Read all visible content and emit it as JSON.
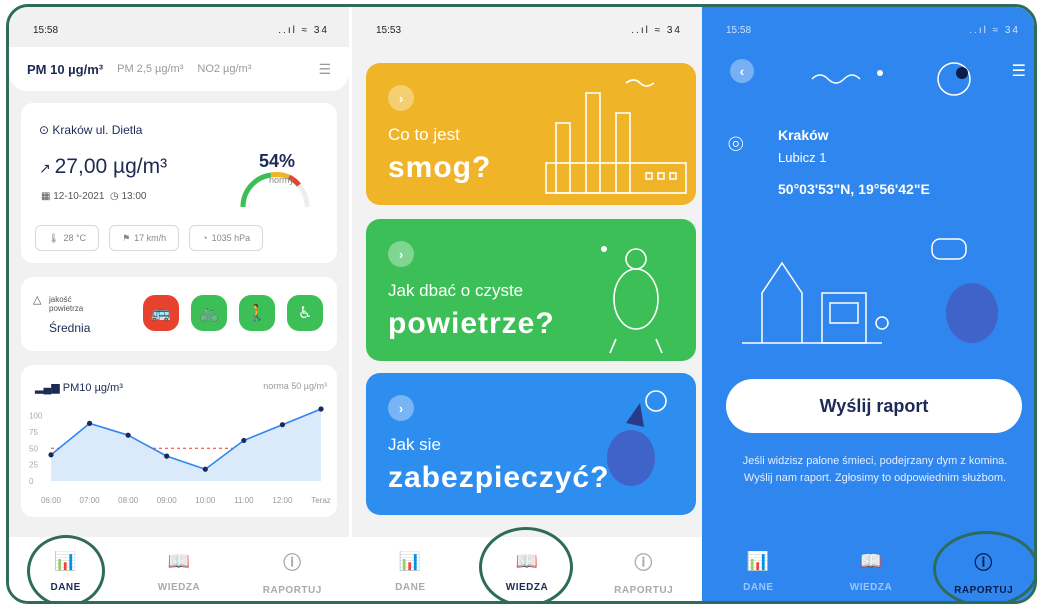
{
  "screen_dane": {
    "time": "15:58",
    "status_icons": "..ıl ≈ 34",
    "tabs": [
      "PM 10 µg/m³",
      "PM 2,5 µg/m³",
      "NO2 µg/m³"
    ],
    "location": "Kraków ul. Dietla",
    "value": "27,00 µg/m³",
    "norm_pct": "54%",
    "norm_label": "normy",
    "date": "12-10-2021",
    "hour": "13:00",
    "temperature": "28 °C",
    "wind": "17 km/h",
    "pressure": "1035 hPa",
    "air_quality_label": "jakość powietrza",
    "air_quality_value": "Średnia",
    "chart_title": "PM10 µg/m³",
    "chart_norm": "norma 50 µg/m³"
  },
  "chart_data": {
    "type": "line",
    "title": "PM10 µg/m³",
    "x": [
      "06:00",
      "07:00",
      "08:00",
      "09:00",
      "10:00",
      "11:00",
      "12:00",
      "Teraz"
    ],
    "y_ticks": [
      "100",
      "75",
      "50",
      "25",
      "0"
    ],
    "series": [
      {
        "values": [
          40,
          88,
          70,
          38,
          18,
          62,
          86,
          110
        ]
      }
    ],
    "norm_line": 50,
    "ylim": [
      0,
      110
    ]
  },
  "screen_wiedza": {
    "time": "15:53",
    "cards": [
      {
        "line1": "Co to jest",
        "line2": "smog?",
        "color": "#f0b429"
      },
      {
        "line1": "Jak dbać o czyste",
        "line2": "powietrze?",
        "color": "#3dbf58"
      },
      {
        "line1": "Jak sie",
        "line2": "zabezpieczyć?",
        "color": "#2e8ef0"
      }
    ]
  },
  "screen_raportuj": {
    "time": "15:58",
    "city": "Kraków",
    "street": "Lubicz 1",
    "coords": "50°03'53\"N, 19°56'42\"E",
    "send_button": "Wyślij raport",
    "info": "Jeśli widzisz palone śmieci, podejrzany dym z komina. Wyślij nam raport. Zgłosimy to odpowiednim służbom."
  },
  "nav": {
    "dane": "DANE",
    "wiedza": "WIEDZA",
    "raportuj": "RAPORTUJ"
  },
  "colors": {
    "accent_dark": "#1d2a55",
    "report_blue": "#2f86ee",
    "highlight_ring": "#2f6b5a",
    "bus": "#e8412d",
    "green": "#3dbf58"
  }
}
